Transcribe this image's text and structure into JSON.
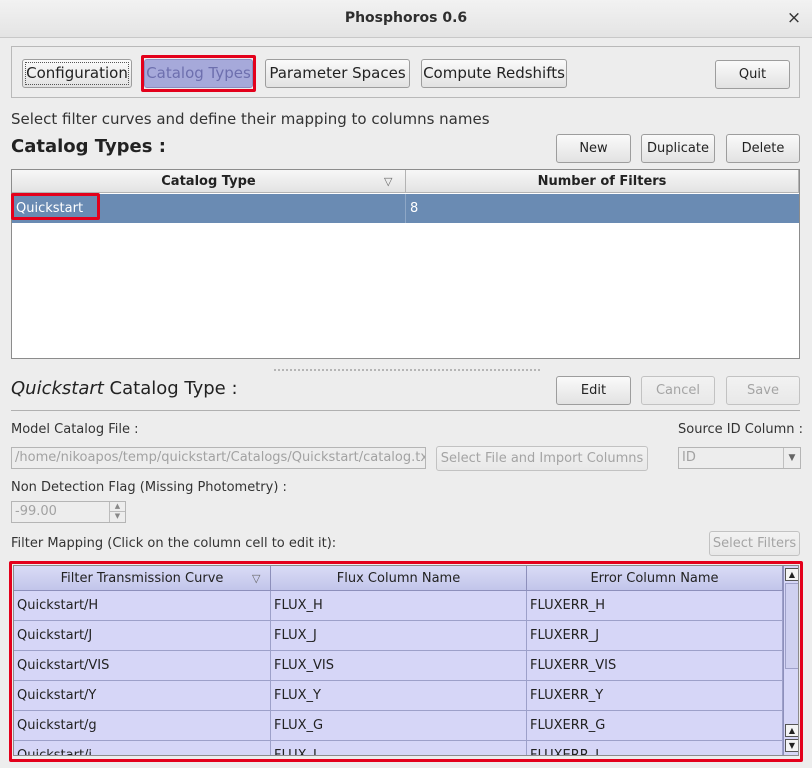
{
  "window": {
    "title": "Phosphoros 0.6",
    "close_glyph": "×"
  },
  "nav": {
    "configuration": "Configuration",
    "catalog_types": "Catalog Types",
    "parameter_spaces": "Parameter Spaces",
    "compute_redshifts": "Compute Redshifts",
    "quit": "Quit"
  },
  "catalog_section": {
    "description": "Select filter curves and define their mapping to columns names",
    "title": "Catalog Types :",
    "new": "New",
    "duplicate": "Duplicate",
    "delete": "Delete",
    "columns": [
      "Catalog Type",
      "Number of Filters"
    ],
    "rows": [
      {
        "catalog_type": "Quickstart",
        "num_filters": "8"
      }
    ]
  },
  "detail": {
    "title_italic": "Quickstart",
    "title_rest": " Catalog Type :",
    "edit": "Edit",
    "cancel": "Cancel",
    "save": "Save",
    "model_catalog_label": "Model Catalog File :",
    "model_catalog_value": "/home/nikoapos/temp/quickstart/Catalogs/Quickstart/catalog.txt",
    "select_file": "Select File and Import Columns",
    "source_id_label": "Source ID Column :",
    "source_id_value": "ID",
    "non_detection_label": "Non Detection Flag (Missing Photometry) :",
    "non_detection_value": "-99.00",
    "filter_mapping_label": "Filter Mapping (Click on the column cell to edit it):",
    "select_filters": "Select Filters"
  },
  "filter_table": {
    "columns": [
      "Filter Transmission Curve",
      "Flux Column Name",
      "Error Column Name"
    ],
    "rows": [
      {
        "curve": "Quickstart/H",
        "flux": "FLUX_H",
        "error": "FLUXERR_H"
      },
      {
        "curve": "Quickstart/J",
        "flux": "FLUX_J",
        "error": "FLUXERR_J"
      },
      {
        "curve": "Quickstart/VIS",
        "flux": "FLUX_VIS",
        "error": "FLUXERR_VIS"
      },
      {
        "curve": "Quickstart/Y",
        "flux": "FLUX_Y",
        "error": "FLUXERR_Y"
      },
      {
        "curve": "Quickstart/g",
        "flux": "FLUX_G",
        "error": "FLUXERR_G"
      },
      {
        "curve": "Quickstart/i",
        "flux": "FLUX_I",
        "error": "FLUXERR_I"
      }
    ]
  },
  "colors": {
    "highlight_border": "#e3001b",
    "selected_row": "#6a8bb3",
    "mapping_background": "#d6d6f7"
  }
}
